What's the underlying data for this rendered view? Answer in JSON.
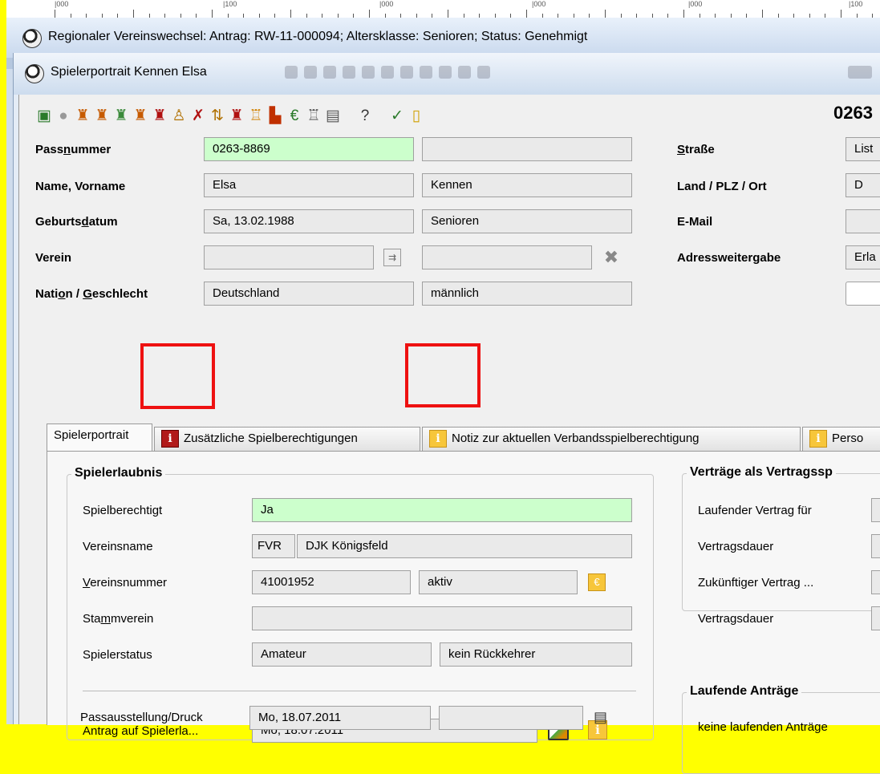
{
  "ruler": {
    "labels": [
      "|000",
      "|100",
      "|000",
      "|000",
      "|000",
      "|100"
    ]
  },
  "outer_window": {
    "title": "Regionaler Vereinswechsel: Antrag: RW-11-000094; Altersklasse: Senioren; Status: Genehmigt"
  },
  "inner_window": {
    "title": "Spielerportrait Kennen Elsa",
    "pass_number_header": "0263"
  },
  "toolbar": {
    "icons": [
      "portrait-icon",
      "circle-icon",
      "shirt-icon",
      "shirt-add-icon",
      "shirt-edit-icon",
      "shirt-multi-icon",
      "shirt-2-icon",
      "person-icon",
      "shirt-delete-icon",
      "transfer-icon",
      "shirt-red-icon",
      "shirt-outline-icon",
      "flag-icon",
      "euro-doc-icon",
      "shirt-white-icon",
      "card-icon",
      "help-icon",
      "check-doc-icon",
      "doc-edit-icon"
    ]
  },
  "form": {
    "passnummer": {
      "label_pre": "Pass",
      "label_ul": "n",
      "label_post": "ummer",
      "value": "0263-8869",
      "extra": ""
    },
    "name": {
      "label": "Name, Vorname",
      "vorname": "Elsa",
      "nachname": "Kennen"
    },
    "geburtsdatum": {
      "label_pre": "Geburts",
      "label_ul": "d",
      "label_post": "atum",
      "value": "Sa, 13.02.1988",
      "klasse": "Senioren"
    },
    "verein": {
      "label": "Verein",
      "value1": "",
      "value2": ""
    },
    "nation": {
      "label_pre": "Nati",
      "label_ul": "o",
      "label_mid": "n / ",
      "label_ul2": "G",
      "label_post": "eschlecht",
      "value": "Deutschland",
      "geschlecht": "männlich"
    },
    "strasse": {
      "label_ul": "S",
      "label_post": "traße",
      "value": "List"
    },
    "land": {
      "label": "Land / PLZ / Ort",
      "value": "D"
    },
    "email": {
      "label": "E-Mail",
      "value": ""
    },
    "adressweitergabe": {
      "label": "Adressweitergabe",
      "value": "Erla"
    }
  },
  "tabs": [
    {
      "label": "Spielerportrait",
      "icon": ""
    },
    {
      "label": "Zusätzliche Spielberechtigungen",
      "icon": "i"
    },
    {
      "label": "Notiz zur aktuellen Verbandsspielberechtigung",
      "icon": "i"
    },
    {
      "label": "Perso",
      "icon": "i"
    }
  ],
  "spielerlaubnis": {
    "title": "Spielerlaubnis",
    "spielberechtigt": {
      "label": "Spielberechtigt",
      "value": "Ja"
    },
    "vereinsname": {
      "label": "Vereinsname",
      "code": "FVR",
      "value": "DJK Königsfeld"
    },
    "vereinsnummer": {
      "label_ul": "V",
      "label_post": "ereinsnummer",
      "value": "41001952",
      "status": "aktiv"
    },
    "stammverein": {
      "label_pre": "Sta",
      "label_ul": "m",
      "label_post": "mverein",
      "value": ""
    },
    "spielerstatus": {
      "label": "Spielerstatus",
      "value": "Amateur",
      "extra": "kein Rückkehrer"
    },
    "antrag": {
      "label": "Antrag auf Spielerla...",
      "value": "Mo, 18.07.2011"
    },
    "passausstellung": {
      "label": "Passausstellung/Druck",
      "value": "Mo, 18.07.2011",
      "extra": ""
    }
  },
  "vertraege": {
    "title": "Verträge als Vertragssp",
    "rows": [
      "Laufender Vertrag für",
      "Vertragsdauer",
      "Zukünftiger Vertrag ...",
      "Vertragsdauer"
    ]
  },
  "antraege": {
    "title": "Laufende Anträge",
    "text": "keine laufenden Anträge"
  },
  "colors": {
    "highlight": "#ee1111",
    "green_field": "#ccffcc",
    "info_red": "#b11a1a",
    "info_yellow": "#f7c63a"
  }
}
